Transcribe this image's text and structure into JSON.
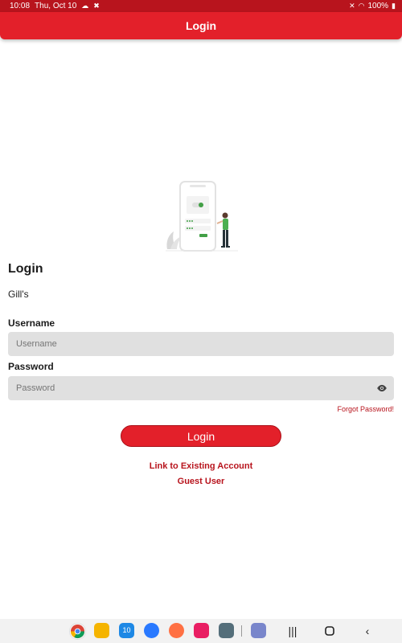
{
  "status_bar": {
    "time": "10:08",
    "date": "Thu, Oct 10",
    "battery": "100%"
  },
  "app_bar": {
    "title": "Login"
  },
  "form": {
    "heading": "Login",
    "company": "Gill's",
    "username_label": "Username",
    "username_placeholder": "Username",
    "password_label": "Password",
    "password_placeholder": "Password",
    "forgot_label": "Forgot Password!",
    "login_button": "Login",
    "link_existing": "Link to Existing Account",
    "guest_user": "Guest User"
  },
  "dock": {
    "apps": [
      "chrome-icon",
      "files-icon",
      "calendar-icon",
      "messages-icon",
      "contacts-icon",
      "camera-icon",
      "app-drawer-icon",
      "avatar-app-icon"
    ],
    "calendar_day": "10"
  },
  "colors": {
    "primary": "#e3202a",
    "status_bar": "#b8141d",
    "input_bg": "#e0e0e0",
    "link": "#b8141d"
  }
}
